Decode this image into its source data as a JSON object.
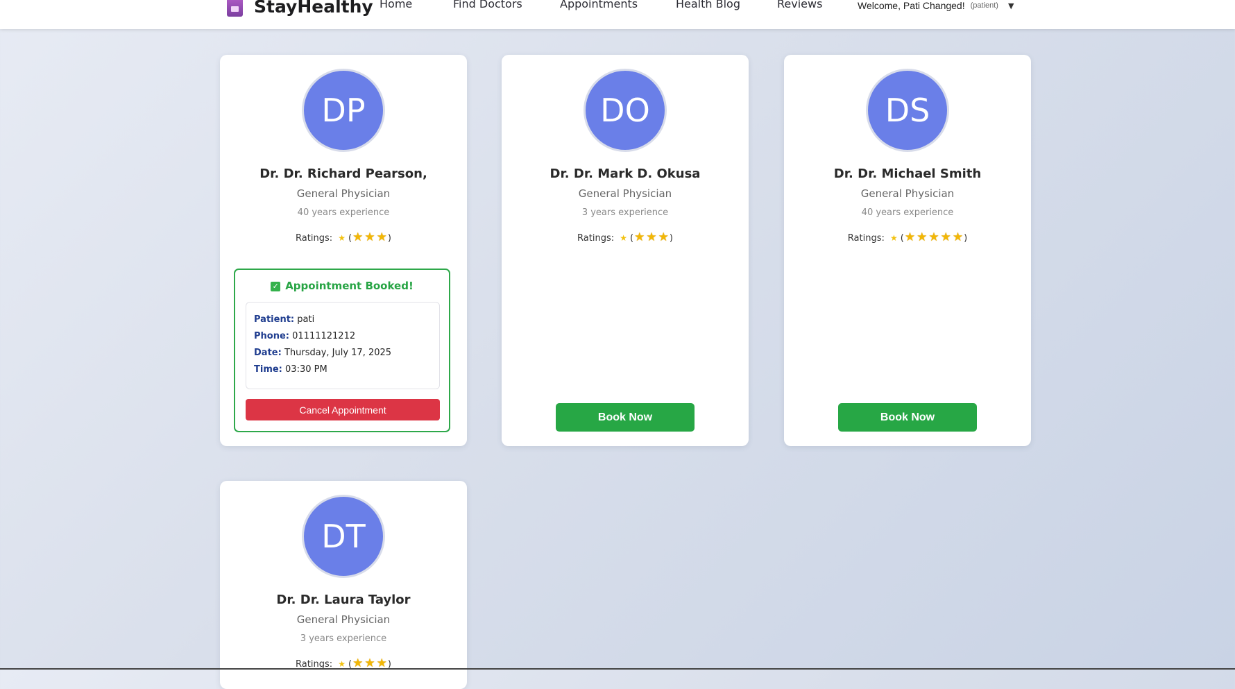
{
  "nav": {
    "brand": "StayHealthy",
    "links": [
      "Home",
      "Find Doctors",
      "Appointments",
      "Health Blog",
      "Reviews"
    ],
    "welcome": "Welcome, Pati Changed!",
    "role": "(patient)",
    "caret": "▼"
  },
  "doctors": [
    {
      "initials": "DP",
      "name": "Dr. Dr. Richard Pearson,",
      "specialty": "General Physician",
      "experience": "40 years experience",
      "ratings_label": "Ratings:",
      "rating": 3,
      "booking": {
        "title": "Appointment Booked!",
        "patient_label": "Patient:",
        "patient": "pati",
        "phone_label": "Phone:",
        "phone": "01111121212",
        "date_label": "Date:",
        "date": "Thursday, July 17, 2025",
        "time_label": "Time:",
        "time": "03:30 PM",
        "cancel_label": "Cancel Appointment"
      }
    },
    {
      "initials": "DO",
      "name": "Dr. Dr. Mark D. Okusa",
      "specialty": "General Physician",
      "experience": "3 years experience",
      "ratings_label": "Ratings:",
      "rating": 3,
      "book_label": "Book Now"
    },
    {
      "initials": "DS",
      "name": "Dr. Dr. Michael Smith",
      "specialty": "General Physician",
      "experience": "40 years experience",
      "ratings_label": "Ratings:",
      "rating": 5,
      "book_label": "Book Now"
    },
    {
      "initials": "DT",
      "name": "Dr. Dr. Laura Taylor",
      "specialty": "General Physician",
      "experience": "3 years experience",
      "ratings_label": "Ratings:",
      "rating": 3
    }
  ],
  "colors": {
    "avatar": "#6a7fe8",
    "book_button": "#27a745",
    "cancel_button": "#dc3545",
    "booked_border": "#2ea84a",
    "star": "#f2b705"
  },
  "icons": {
    "logo": "stayhealthy-logo-icon",
    "booked": "checkbox-check-icon",
    "star": "star-icon",
    "dropdown": "chevron-down-icon"
  }
}
